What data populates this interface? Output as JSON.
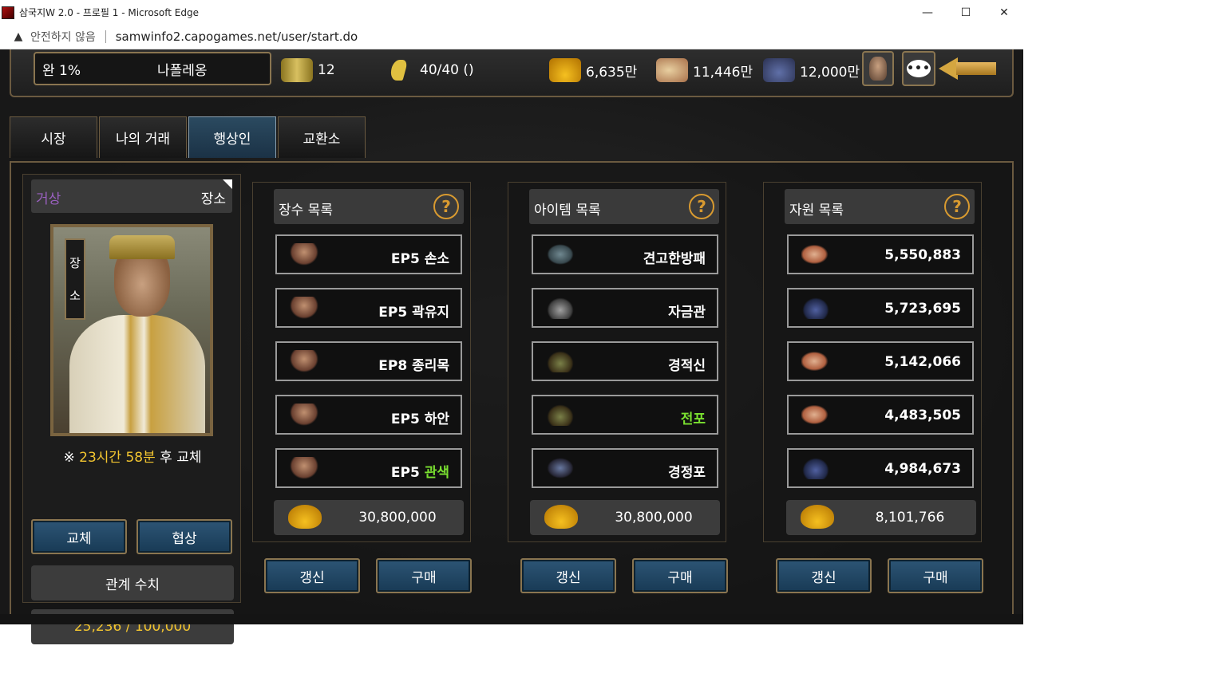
{
  "window": {
    "title": "삼국지W 2.0 - 프로필 1 - Microsoft Edge",
    "controls": [
      "—",
      "☐",
      "✕"
    ]
  },
  "addressbar": {
    "security_warning": "안전하지 않음",
    "url": "samwinfo2.capogames.net/user/start.do"
  },
  "status": {
    "rank": "완 1%",
    "player_name": "나폴레옹",
    "scroll_count": "12",
    "stamina": "40/40 ()",
    "gold": "6,635만",
    "food": "11,446만",
    "ore": "12,000만",
    "chat_glyph": "•••"
  },
  "tabs": [
    {
      "label": "시장",
      "active": false
    },
    {
      "label": "나의 거래",
      "active": false
    },
    {
      "label": "행상인",
      "active": true
    },
    {
      "label": "교환소",
      "active": false
    }
  ],
  "merchant": {
    "type_label": "거상",
    "merchant_name": "장소",
    "banner_chars": [
      "장",
      "소"
    ],
    "timer_prefix": "※",
    "timer_hours": "23시간 58분",
    "timer_suffix": "후 교체",
    "replace_label": "교체",
    "negotiate_label": "협상",
    "relation_label": "관계 수치",
    "relation_value": "25,236 / 100,000"
  },
  "general_list": {
    "title": "장수 목록",
    "help_glyph": "?",
    "items": [
      {
        "prefix": "EP5",
        "name": "손소",
        "highlight": false,
        "icon": "general-figure-icon"
      },
      {
        "prefix": "EP5",
        "name": "곽유지",
        "highlight": false,
        "icon": "general-figure-icon"
      },
      {
        "prefix": "EP8",
        "name": "종리목",
        "highlight": false,
        "icon": "general-figure-icon"
      },
      {
        "prefix": "EP5",
        "name": "하안",
        "highlight": false,
        "icon": "general-figure-icon"
      },
      {
        "prefix": "EP5",
        "name": "관색",
        "highlight": true,
        "icon": "general-figure-icon"
      }
    ],
    "price": "30,800,000",
    "refresh_label": "갱신",
    "buy_label": "구매"
  },
  "item_list": {
    "title": "아이템 목록",
    "help_glyph": "?",
    "items": [
      {
        "name": "견고한방패",
        "highlight": false,
        "icon": "shield-icon"
      },
      {
        "name": "자금관",
        "highlight": false,
        "icon": "helmet-icon"
      },
      {
        "name": "경적신",
        "highlight": false,
        "icon": "boots-icon"
      },
      {
        "name": "전포",
        "highlight": true,
        "icon": "boots-icon"
      },
      {
        "name": "경정포",
        "highlight": false,
        "icon": "armor-icon"
      }
    ],
    "price": "30,800,000",
    "refresh_label": "갱신",
    "buy_label": "구매"
  },
  "resource_list": {
    "title": "자원 목록",
    "help_glyph": "?",
    "items": [
      {
        "value": "5,550,883",
        "icon": "rice-bag-icon"
      },
      {
        "value": "5,723,695",
        "icon": "ore-pile-icon"
      },
      {
        "value": "5,142,066",
        "icon": "rice-bag-icon"
      },
      {
        "value": "4,483,505",
        "icon": "rice-bag-icon"
      },
      {
        "value": "4,984,673",
        "icon": "ore-pile-icon"
      }
    ],
    "price": "8,101,766",
    "refresh_label": "갱신",
    "buy_label": "구매"
  },
  "colors": {
    "accent_gold": "#f2c530",
    "highlight_green": "#7ae030",
    "merchant_type_purple": "#9a60c0",
    "active_tab_blue": "#2b4a60",
    "frame_bronze": "#6b5a40"
  }
}
